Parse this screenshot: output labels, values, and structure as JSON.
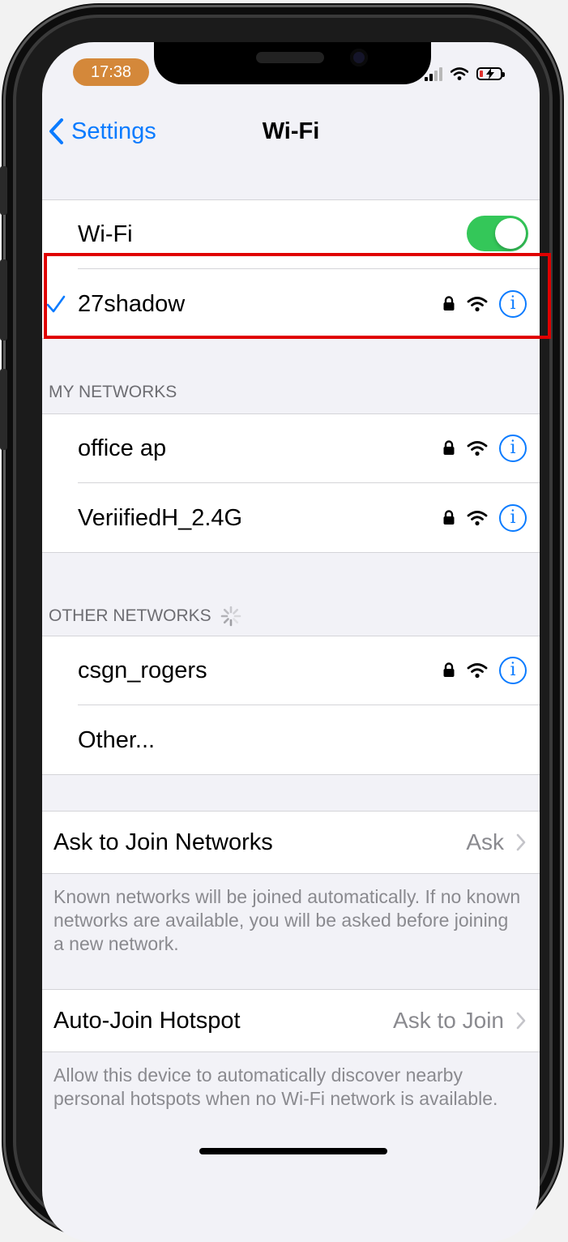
{
  "status_bar": {
    "time": "17:38"
  },
  "nav": {
    "back_label": "Settings",
    "title": "Wi-Fi"
  },
  "wifi": {
    "label": "Wi-Fi",
    "enabled": true,
    "connected_network": "27shadow"
  },
  "my_networks": {
    "header": "MY NETWORKS",
    "items": [
      {
        "name": "office ap"
      },
      {
        "name": "VeriifiedH_2.4G"
      }
    ]
  },
  "other_networks": {
    "header": "OTHER NETWORKS",
    "items": [
      {
        "name": "csgn_rogers"
      }
    ],
    "other_label": "Other..."
  },
  "ask_to_join": {
    "label": "Ask to Join Networks",
    "value": "Ask",
    "footer": "Known networks will be joined automatically. If no known networks are available, you will be asked before joining a new network."
  },
  "auto_join_hotspot": {
    "label": "Auto-Join Hotspot",
    "value": "Ask to Join",
    "footer": "Allow this device to automatically discover nearby personal hotspots when no Wi-Fi network is available."
  },
  "colors": {
    "accent": "#0a7bff",
    "toggle_on": "#34c759",
    "highlight": "#e00000",
    "time_pill": "#d4883a"
  },
  "icons": {
    "lock": "lock-icon",
    "wifi": "wifi-icon",
    "info": "info-icon"
  }
}
